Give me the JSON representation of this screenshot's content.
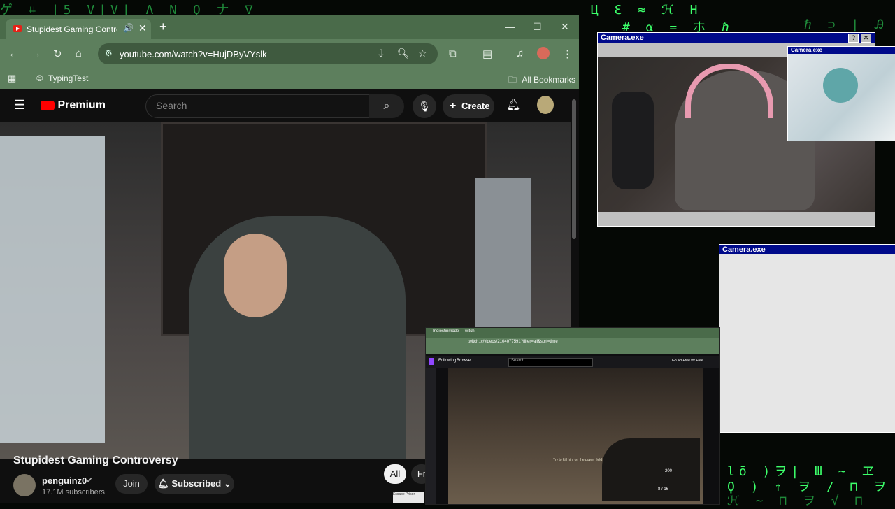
{
  "backdrop": {
    "glyph_rows": [
      "ゲ ⌗ |5  V|V| Λ  N  Ϙ ナ ∇",
      "Ц  Ɛ  ≈ ℋ  H",
      "# α =  ホ  ℏ",
      "ℏ ⊃ | Ꭿ",
      "lō )ヲ| Ш ~ ヱ",
      "Ϙ ) ↑ ヲ / ⊓ ヲ",
      "ℋ ~ ⊓ ヲ √ ⊓"
    ]
  },
  "browser": {
    "tab_title": "Stupidest Gaming Controversy",
    "url": "youtube.com/watch?v=HujDByVYslk",
    "bookmark": "TypingTest",
    "all_bookmarks": "All Bookmarks",
    "colors": {
      "frame": "#4a6b4a",
      "toolbar": "#5d7f5d"
    }
  },
  "youtube": {
    "logo_text": "Premium",
    "search_placeholder": "Search",
    "create_label": "Create",
    "video_title": "Stupidest Gaming Controversy",
    "channel_name": "penguinz0",
    "subscribers": "17.1M subscribers",
    "join_label": "Join",
    "subscribed_label": "Subscribed",
    "chips": [
      "All",
      "Fr"
    ]
  },
  "camera_windows": {
    "main_title": "Camera.exe",
    "small_title": "Camera.exe",
    "third_title": "Camera.exe"
  },
  "twitch": {
    "tab_title": "Indiestinmode - Twitch",
    "url": "twitch.tv/videos/2104077591?filter=all&sort=time",
    "following": "Following",
    "browse": "Browse",
    "search": "Search",
    "ad_free": "Go Ad-Free for Free",
    "hud_objective": "Try to kill him on the power field",
    "hud_points": "200",
    "hud_ammo": "8 / 16"
  },
  "chat_snippet": "Escape Prison"
}
